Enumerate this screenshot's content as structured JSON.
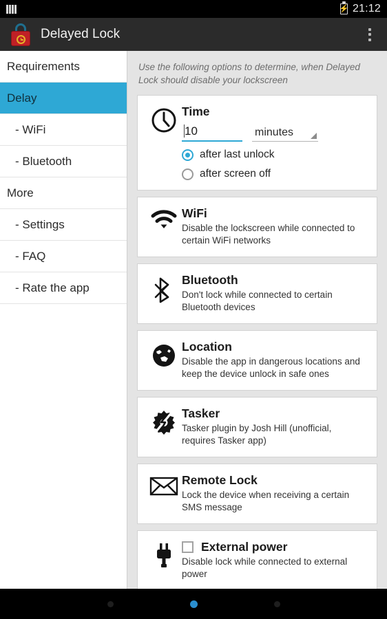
{
  "statusbar": {
    "signal_icon": "signal-bars-icon",
    "battery_icon": "battery-charging-icon",
    "time": "21:12"
  },
  "appbar": {
    "app_icon": "delayed-lock-padlock-icon",
    "title": "Delayed Lock",
    "overflow_icon": "overflow-menu-icon"
  },
  "sidebar": {
    "items": [
      {
        "label": "Requirements",
        "sub": false,
        "active": false
      },
      {
        "label": "Delay",
        "sub": false,
        "active": true
      },
      {
        "label": "- WiFi",
        "sub": true,
        "active": false
      },
      {
        "label": "- Bluetooth",
        "sub": true,
        "active": false
      },
      {
        "label": "More",
        "sub": false,
        "active": false
      },
      {
        "label": "- Settings",
        "sub": true,
        "active": false
      },
      {
        "label": "- FAQ",
        "sub": true,
        "active": false
      },
      {
        "label": "- Rate the app",
        "sub": true,
        "active": false
      }
    ]
  },
  "main": {
    "intro": "Use the following options to determine, when Delayed Lock should disable your lockscreen",
    "time_card": {
      "icon": "clock-icon",
      "title": "Time",
      "value": "10",
      "unit": "minutes",
      "unit_caret_icon": "dropdown-caret-icon",
      "options": [
        {
          "label": "after last unlock",
          "selected": true
        },
        {
          "label": "after screen off",
          "selected": false
        }
      ]
    },
    "cards": [
      {
        "icon": "wifi-icon",
        "title": "WiFi",
        "desc": "Disable the lockscreen while connected to certain WiFi networks"
      },
      {
        "icon": "bluetooth-icon",
        "title": "Bluetooth",
        "desc": "Don't lock while connected to certain Bluetooth devices"
      },
      {
        "icon": "globe-location-icon",
        "title": "Location",
        "desc": "Disable the app in dangerous locations and keep the device unlock in safe ones"
      },
      {
        "icon": "tasker-gear-icon",
        "title": "Tasker",
        "desc": "Tasker plugin by Josh Hill (unofficial, requires Tasker app)"
      },
      {
        "icon": "envelope-icon",
        "title": "Remote Lock",
        "desc": "Lock the device when receiving a certain SMS message"
      }
    ],
    "power_card": {
      "icon": "power-plug-icon",
      "title": "External power",
      "checked": false,
      "desc": "Disable lock while connected to external power"
    }
  },
  "navbar": {
    "back_icon": "nav-back-dot",
    "home_icon": "nav-home-dot",
    "recents_icon": "nav-recents-dot"
  },
  "colors": {
    "accent": "#2ea8d5",
    "appbar": "#2b2b2b",
    "page_bg": "#e4e4e4",
    "lock_red": "#c02026"
  }
}
